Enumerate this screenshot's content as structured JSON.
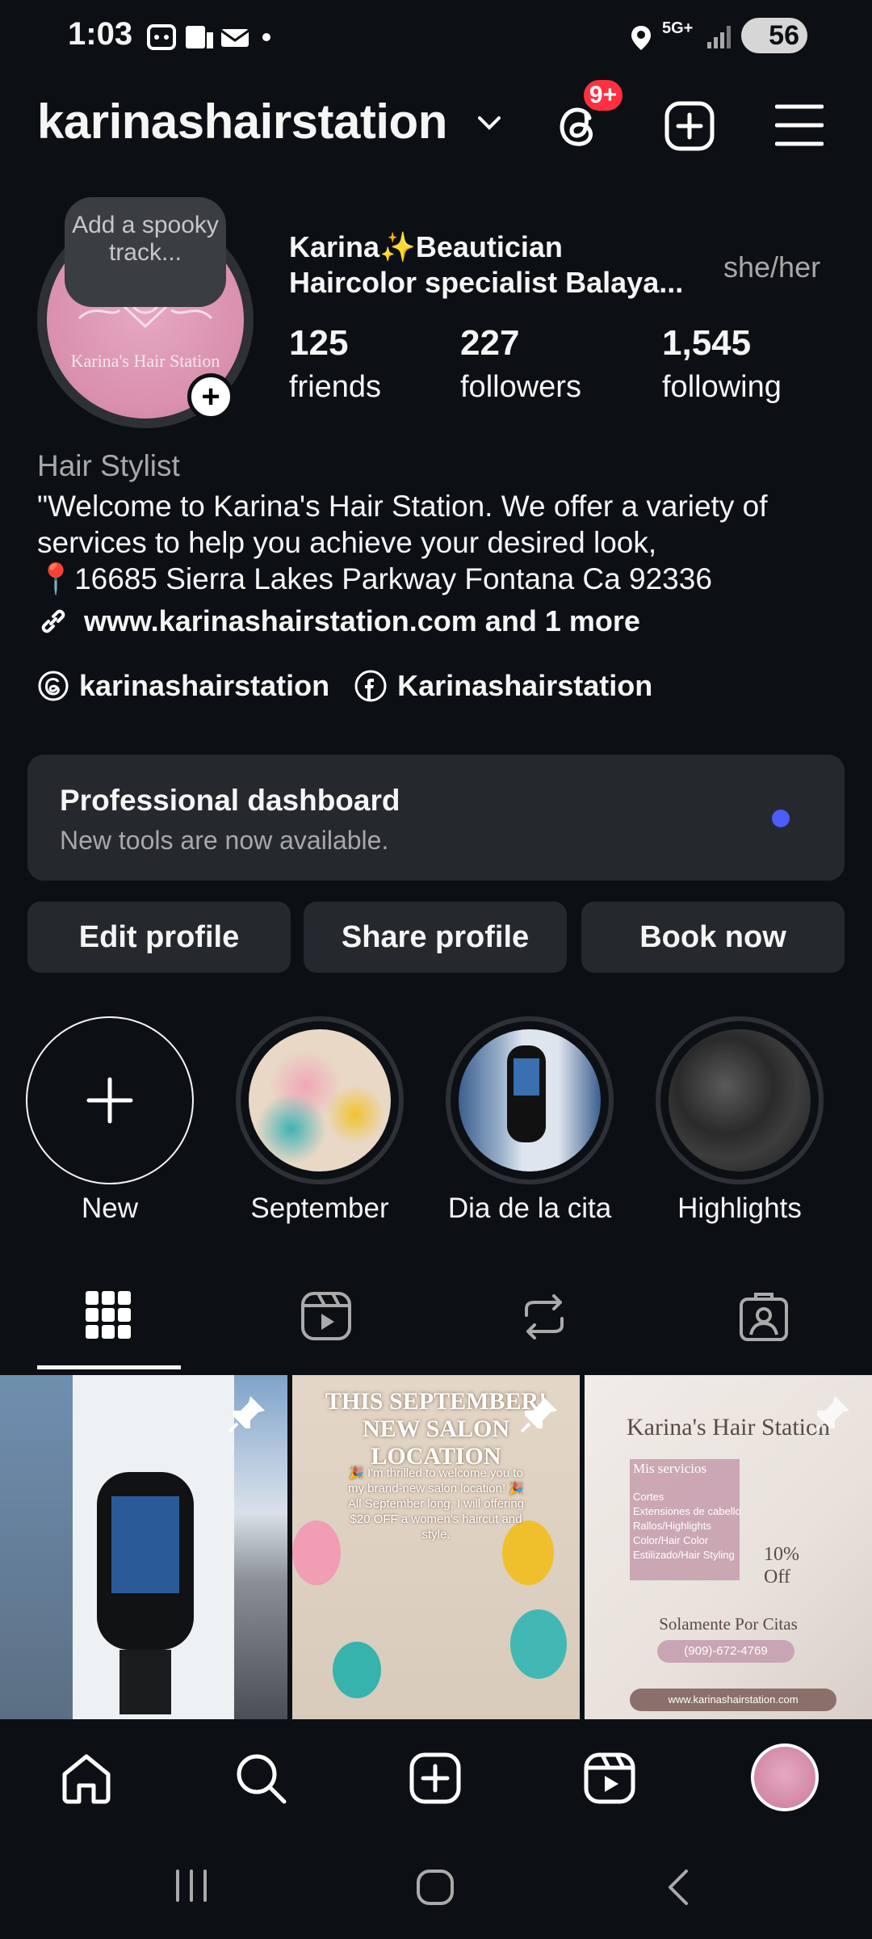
{
  "status_bar": {
    "time": "1:03",
    "battery": "56",
    "network": "5G+"
  },
  "header": {
    "username": "karinashairstation",
    "notification_badge": "9+"
  },
  "profile": {
    "note": "Add a spooky track...",
    "avatar_text": "Karina's Hair Station",
    "display_name_line1": "Karina✨Beautician",
    "display_name_line2": "Haircolor specialist Balaya...",
    "pronouns": "she/her",
    "stats": [
      {
        "value": "125",
        "label": "friends"
      },
      {
        "value": "227",
        "label": "followers"
      },
      {
        "value": "1,545",
        "label": "following"
      }
    ],
    "category": "Hair Stylist",
    "bio_line1": "\"Welcome to Karina's Hair Station. We offer a variety of",
    "bio_line2": "services to help you achieve your desired look,",
    "bio_line3": "📍16685 Sierra Lakes Parkway Fontana Ca 92336",
    "link": "www.karinashairstation.com and 1 more",
    "threads_handle": "karinashairstation",
    "facebook_handle": "Karinashairstation"
  },
  "dashboard": {
    "title": "Professional dashboard",
    "subtitle": "New tools are now available."
  },
  "buttons": {
    "edit": "Edit profile",
    "share": "Share profile",
    "book": "Book now"
  },
  "highlights": [
    {
      "label": "New"
    },
    {
      "label": "September"
    },
    {
      "label": "Dia de la cita"
    },
    {
      "label": "Highlights"
    }
  ],
  "posts": {
    "post2_title": "THIS SEPTEMBER! NEW SALON LOCATION",
    "post2_body": "🎉 I'm thrilled to welcome you to my brand-new salon location! 🎉 All September long, I will offering $20 OFF a women's haircut and style.",
    "post3_title": "Karina's Hair Station",
    "post3_sub": "Mis servicios",
    "post3_services": [
      "Cortes",
      "Extensiones de cabello",
      "Rallos/Highlights",
      "Color/Hair Color",
      "Estilizado/Hair Styling"
    ],
    "post3_discount": "10% Off",
    "post3_appt": "Solamente Por Citas",
    "post3_phone": "(909)-672-4769",
    "post3_web": "www.karinashairstation.com"
  },
  "colors": {
    "background": "#0c1014",
    "surface": "#25292e",
    "badge": "#ff3040",
    "dashboard_dot": "#4a5df9"
  }
}
